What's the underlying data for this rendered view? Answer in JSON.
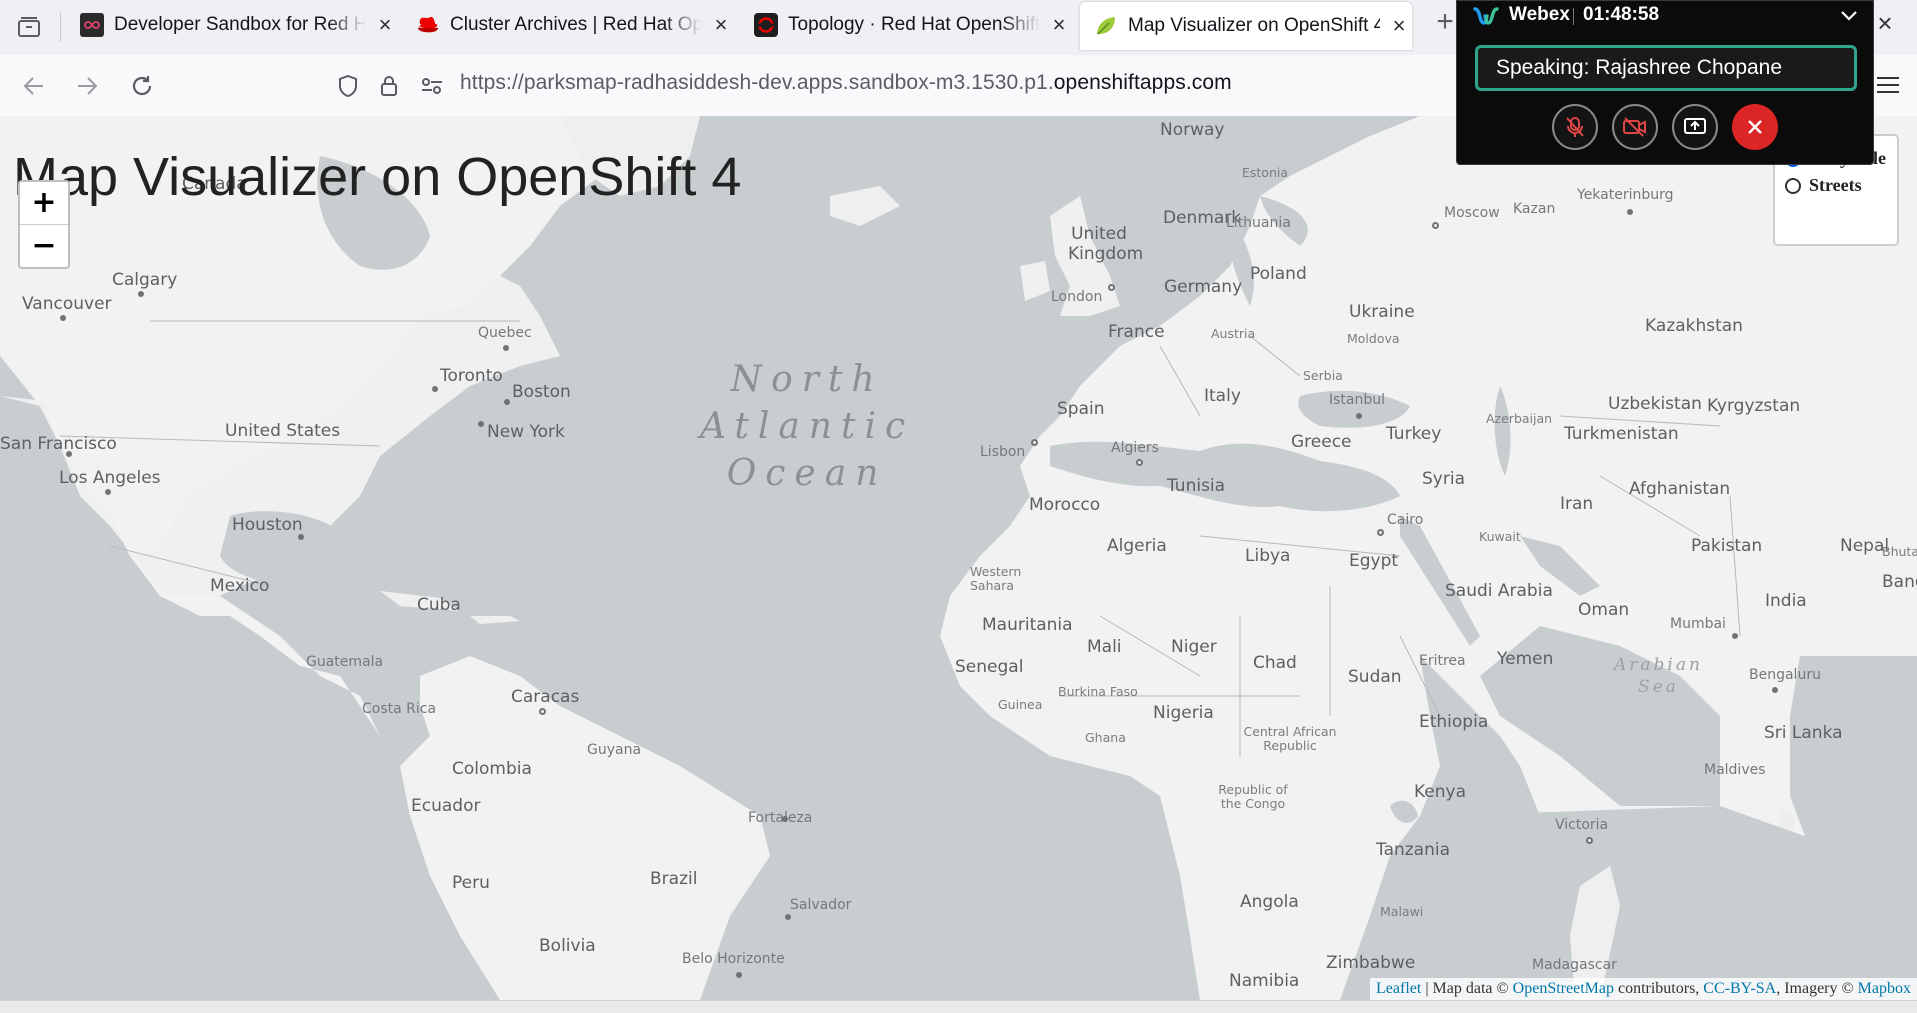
{
  "browser": {
    "tabs": [
      {
        "title": "Developer Sandbox for Red Hat OpenShift",
        "icon": "infinity-icon"
      },
      {
        "title": "Cluster Archives | Red Hat OpenShift",
        "icon": "redhat-hat-icon"
      },
      {
        "title": "Topology · Red Hat OpenShift Dedicated",
        "icon": "openshift-icon"
      },
      {
        "title": "Map Visualizer on OpenShift 4",
        "icon": "leaf-icon",
        "active": true
      }
    ],
    "url_prefix": "https://parksmap-radhasiddesh-dev.apps.sandbox-m3.1530.p1.",
    "url_domain": "openshiftapps.com"
  },
  "page": {
    "title": "Map Visualizer on OpenShift 4",
    "zoom_in": "+",
    "zoom_out": "−",
    "layers": [
      {
        "label": "Grayscale",
        "selected": true
      },
      {
        "label": "Streets",
        "selected": false
      }
    ],
    "attribution": {
      "leaflet": "Leaflet",
      "sep": " | Map data © ",
      "osm": "OpenStreetMap",
      "contrib": " contributors, ",
      "ccbysa": "CC-BY-SA",
      "imagery": ", Imagery © ",
      "mapbox": "Mapbox"
    }
  },
  "map_labels": {
    "ocean": "North Atlantic Ocean",
    "ocean_lines": [
      "North",
      "Atlantic",
      "Ocean"
    ],
    "arabian_sea": [
      "Arabian",
      "Sea"
    ],
    "places": [
      "Canada",
      "Calgary",
      "Vancouver",
      "Quebec",
      "Toronto",
      "Boston",
      "New York",
      "United States",
      "San Francisco",
      "Los Angeles",
      "Houston",
      "Mexico",
      "Cuba",
      "Guatemala",
      "Costa Rica",
      "Caracas",
      "Colombia",
      "Guyana",
      "Ecuador",
      "Peru",
      "Brazil",
      "Fortaleza",
      "Salvador",
      "Bolivia",
      "Belo Horizonte",
      "Norway",
      "Estonia",
      "Denmark",
      "Lithuania",
      "United Kingdom",
      "London",
      "Poland",
      "Germany",
      "Ukraine",
      "Moldova",
      "France",
      "Austria",
      "Serbia",
      "Italy",
      "Spain",
      "Lisbon",
      "Istanbul",
      "Greece",
      "Turkey",
      "Algiers",
      "Tunisia",
      "Morocco",
      "Algeria",
      "Libya",
      "Egypt",
      "Cairo",
      "Western Sahara",
      "Mauritania",
      "Mali",
      "Niger",
      "Chad",
      "Sudan",
      "Senegal",
      "Guinea",
      "Burkina Faso",
      "Nigeria",
      "Ghana",
      "Central African Republic",
      "Eritrea",
      "Ethiopia",
      "Yemen",
      "Republic of the Congo",
      "Kenya",
      "Tanzania",
      "Malawi",
      "Angola",
      "Zimbabwe",
      "Namibia",
      "Madagascar",
      "Moscow",
      "Kazan",
      "Yekaterinburg",
      "Kazakhstan",
      "Uzbekistan",
      "Kyrgyzstan",
      "Azerbaijan",
      "Turkmenistan",
      "Syria",
      "Iran",
      "Afghanistan",
      "Kuwait",
      "Pakistan",
      "Nepal",
      "Bhutan",
      "Bangladesh",
      "Saudi Arabia",
      "Oman",
      "India",
      "Mumbai",
      "Bengaluru",
      "Sri Lanka",
      "Maldives",
      "Victoria"
    ]
  },
  "webex": {
    "app": "Webex",
    "timer": "01:48:58",
    "speaking": "Speaking: Rajashree Chopane"
  }
}
